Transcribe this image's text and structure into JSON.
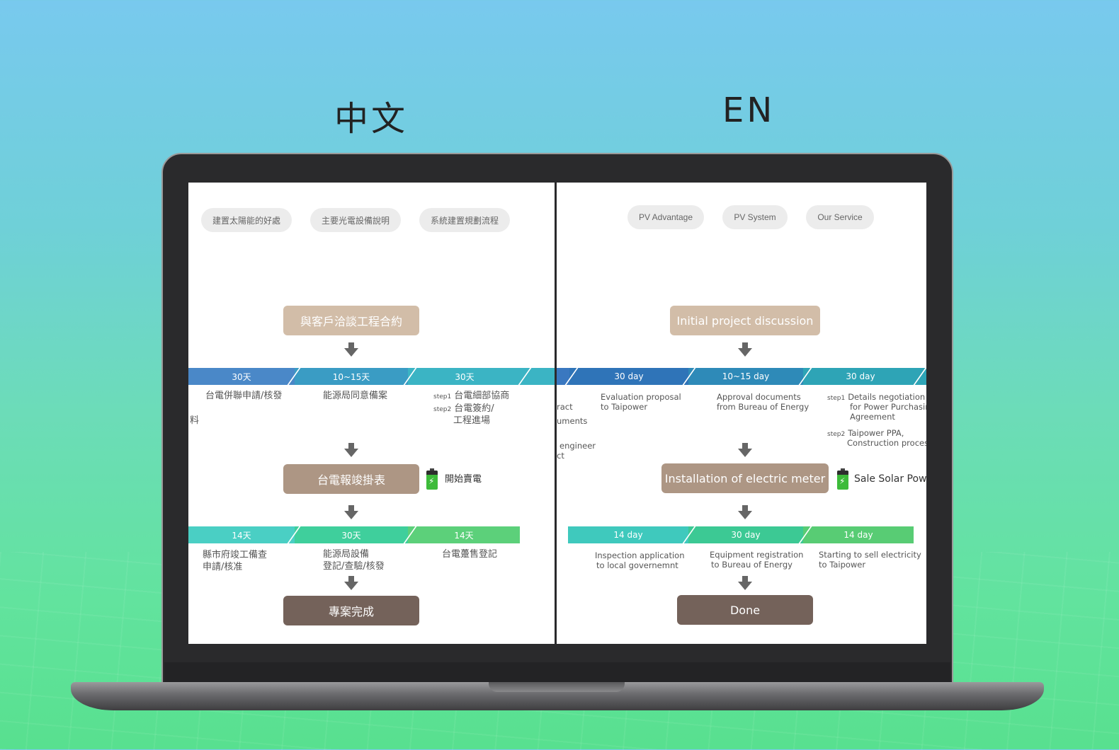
{
  "headings": {
    "zh": "中文",
    "en": "EN"
  },
  "zh": {
    "tabs": [
      "建置太陽能的好處",
      "主要光電設備說明",
      "系統建置規劃流程"
    ],
    "box1": "與客戶洽談工程合約",
    "bar1": [
      "30天",
      "10~15天",
      "30天"
    ],
    "row1": {
      "a": "台電併聯申請/核發",
      "b": "能源局同意備案",
      "c_step1_tag": "step1",
      "c_step1": "台電細部協商",
      "c_step2_tag": "step2",
      "c_step2": "台電簽約/",
      "c_step2b": "工程進場",
      "edge": "料"
    },
    "box2": "台電報竣掛表",
    "sell": "開始賣電",
    "bar2": [
      "14天",
      "30天",
      "14天"
    ],
    "row2": {
      "a1": "縣市府竣工備查",
      "a2": "申請/核准",
      "b1": "能源局設備",
      "b2": "登記/查驗/核發",
      "c": "台電躉售登記"
    },
    "box3": "專案完成"
  },
  "en": {
    "tabs": [
      "PV Advantage",
      "PV System",
      "Our Service"
    ],
    "box1": "Initial project discussion",
    "bar1": [
      "30 day",
      "10~15 day",
      "30 day"
    ],
    "row1": {
      "a1": "Evaluation proposal",
      "a2": "to Taipower",
      "b1": "Approval documents",
      "b2": "from Bureau of Energy",
      "c_step1_tag": "step1",
      "c1": "Details negotiation",
      "c2": "for Power Purchasin",
      "c3": "Agreement",
      "c_step2_tag": "step2",
      "c4": "Taipower PPA,",
      "c5": "Construction proces",
      "edge1": "ract",
      "edge2": "uments",
      "edge3": "engineer",
      "edge4": "ct"
    },
    "box2": "Installation of electric meter",
    "sell": "Sale Solar Powe",
    "bar2": [
      "14 day",
      "30 day",
      "14 day"
    ],
    "row2": {
      "a1": "Inspection application",
      "a2": "to local governemnt",
      "b1": "Equipment registration",
      "b2": "to Bureau of Energy",
      "c1": "Starting to sell electricity",
      "c2": "to Taipower"
    },
    "box3": "Done"
  },
  "colors": {
    "bar1": [
      "#4a88c8",
      "#3a9cc4",
      "#3bb4c4"
    ],
    "bar2": [
      "#4acfc4",
      "#3fcf9c",
      "#5cd07a"
    ],
    "box1": "#d2bda8",
    "box2": "#ad9684",
    "box3": "#74625a"
  }
}
